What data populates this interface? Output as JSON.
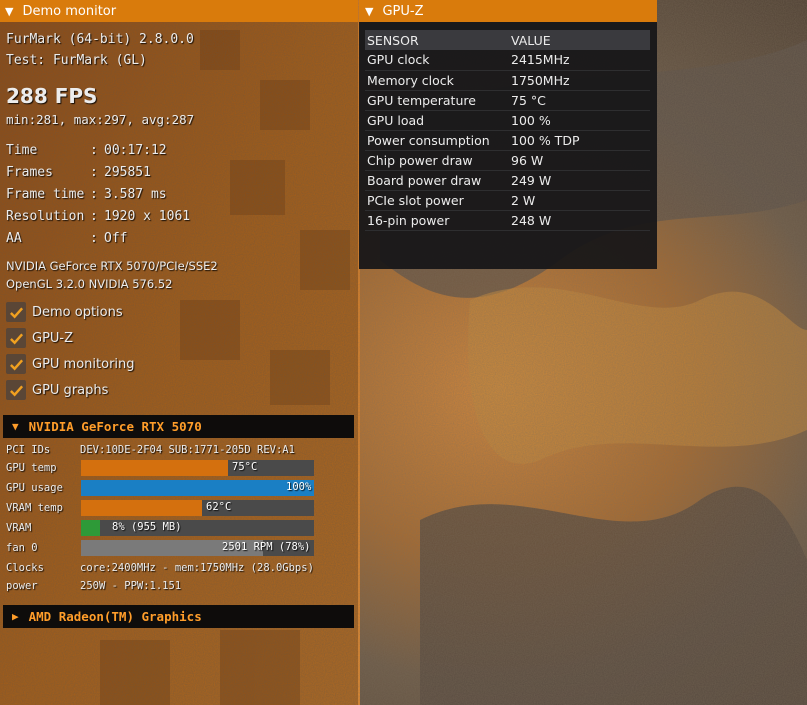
{
  "demo_monitor": {
    "title": "Demo monitor",
    "app_name": "FurMark (64-bit) 2.8.0.0",
    "test_name": "Test: FurMark (GL)",
    "fps": "288 FPS",
    "fps_stats": "min:281, max:297, avg:287",
    "stats": [
      {
        "key": "Time",
        "value": "00:17:12"
      },
      {
        "key": "Frames",
        "value": "295851"
      },
      {
        "key": "Frame time",
        "value": "3.587 ms"
      },
      {
        "key": "Resolution",
        "value": "1920 x 1061"
      },
      {
        "key": "AA",
        "value": "Off"
      }
    ],
    "renderer": "NVIDIA GeForce RTX 5070/PCIe/SSE2",
    "opengl": "OpenGL 3.2.0 NVIDIA 576.52",
    "options": [
      {
        "label": "Demo options",
        "checked": true
      },
      {
        "label": "GPU-Z",
        "checked": true
      },
      {
        "label": "GPU monitoring",
        "checked": true
      },
      {
        "label": "GPU graphs",
        "checked": true
      }
    ]
  },
  "gpu1": {
    "name": "NVIDIA GeForce RTX 5070",
    "pci_label": "PCI IDs",
    "pci_value": "DEV:10DE-2F04 SUB:1771-205D REV:A1",
    "bars": [
      {
        "key": "GPU temp",
        "label": "75°C",
        "fraction": 0.63,
        "color": "#d4700e"
      },
      {
        "key": "GPU usage",
        "label": "100%",
        "fraction": 1.0,
        "color": "#1a7fc4"
      },
      {
        "key": "VRAM temp",
        "label": "62°C",
        "fraction": 0.52,
        "color": "#d4700e"
      },
      {
        "key": "VRAM",
        "label": "8% (955 MB)",
        "fraction": 0.08,
        "color": "#2e9a38"
      },
      {
        "key": "fan 0",
        "label": "2501 RPM (78%)",
        "fraction": 0.78,
        "color": "#7a7a7a"
      }
    ],
    "clocks_label": "Clocks",
    "clocks_value": "core:2400MHz - mem:1750MHz (28.0Gbps)",
    "power_label": "power",
    "power_value": "250W - PPW:1.151"
  },
  "gpu2": {
    "name": "AMD Radeon(TM) Graphics"
  },
  "gpuz": {
    "title": "GPU-Z",
    "col_sensor": "SENSOR",
    "col_value": "VALUE",
    "rows": [
      {
        "sensor": "GPU clock",
        "value": "2415MHz"
      },
      {
        "sensor": "Memory clock",
        "value": "1750MHz"
      },
      {
        "sensor": "GPU temperature",
        "value": "75 °C"
      },
      {
        "sensor": "GPU load",
        "value": "100 %"
      },
      {
        "sensor": "Power consumption",
        "value": "100 % TDP"
      },
      {
        "sensor": "Chip power draw",
        "value": "96 W"
      },
      {
        "sensor": "Board power draw",
        "value": "249 W"
      },
      {
        "sensor": "PCIe slot power",
        "value": "2 W"
      },
      {
        "sensor": "16-pin power",
        "value": "248 W"
      }
    ]
  }
}
